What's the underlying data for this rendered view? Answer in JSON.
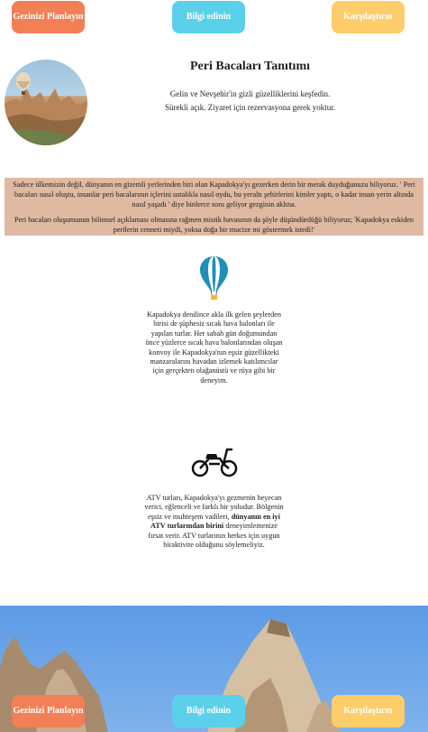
{
  "nav": {
    "plan_label": "Gezinizi Planlayın",
    "info_label": "Bilgi edinin",
    "compare_label": "Karşılaştırın"
  },
  "header": {
    "title": "Peri Bacaları Tanıtımı",
    "subtitle_1": "Gelin ve Nevşehir'in gizli güzelliklerini keşfedin.",
    "subtitle_2": "Sürekli açık. Ziyaret için rezervasyona gerek yoktur."
  },
  "intro": {
    "paragraph_1": "Sadece ülkemizin değil, dünyanın en gizemli yerlerinden biri olan Kapadokya'yı gezerken derin bir merak duyduğunuzu biliyoruz. ' Peri bacaları nasıl oluştu, insanlar peri bacalarının içlerini ustalıkla nasıl oydu, bu yeraltı şehirlerini kimler yaptı, o kadar insan yerin altında nasıl yaşadı ' diye binlerce soru geliyor gezginin aklına.",
    "paragraph_2": "Peri bacaları oluşumunun bilimsel açıklaması olmasına rağmen mistik havasının da şöyle düşündürdüğü biliyoruz; 'Kapadokya eskiden perilerin cenneti miydi, yoksa doğa bir mucize mi göstermek istedi!'"
  },
  "features": {
    "balloon_text": "Kapadokya denilince akla ilk gelen şeylerden birisi de şüphesiz sıcak hava balonları ile yapılan turlar. Her sabah gün doğumundan önce yüzlerce sıcak hava balonlarından oluşan konvoy ile Kapadokya'nın eşsiz güzellikteki manzaralarını havadan izlemek katılımcılar için gerçekten olağanüstü ve rüya gibi bir deneyim.",
    "atv_text_before": "ATV turları, Kapadokya'yı gezmenin heyecan verici, eğlenceli ve farklı bir yoludur. Bölgenin eşsiz ve muhteşem vadileri,",
    "atv_text_bold": "dünyanın en iyi ATV turlarından birini",
    "atv_text_after": "deneyimlemenize fırsat verir. ATV turlarının herkes için uygun biraktivite olduğunu söylemeliyiz."
  },
  "icons": {
    "balloon": "hot-air-balloon-icon",
    "atv": "motorbike-icon"
  },
  "colors": {
    "orange": "#f27f55",
    "blue": "#5bd0ea",
    "yellow": "#fecd6a",
    "intro_background": "#dfb9a1"
  }
}
